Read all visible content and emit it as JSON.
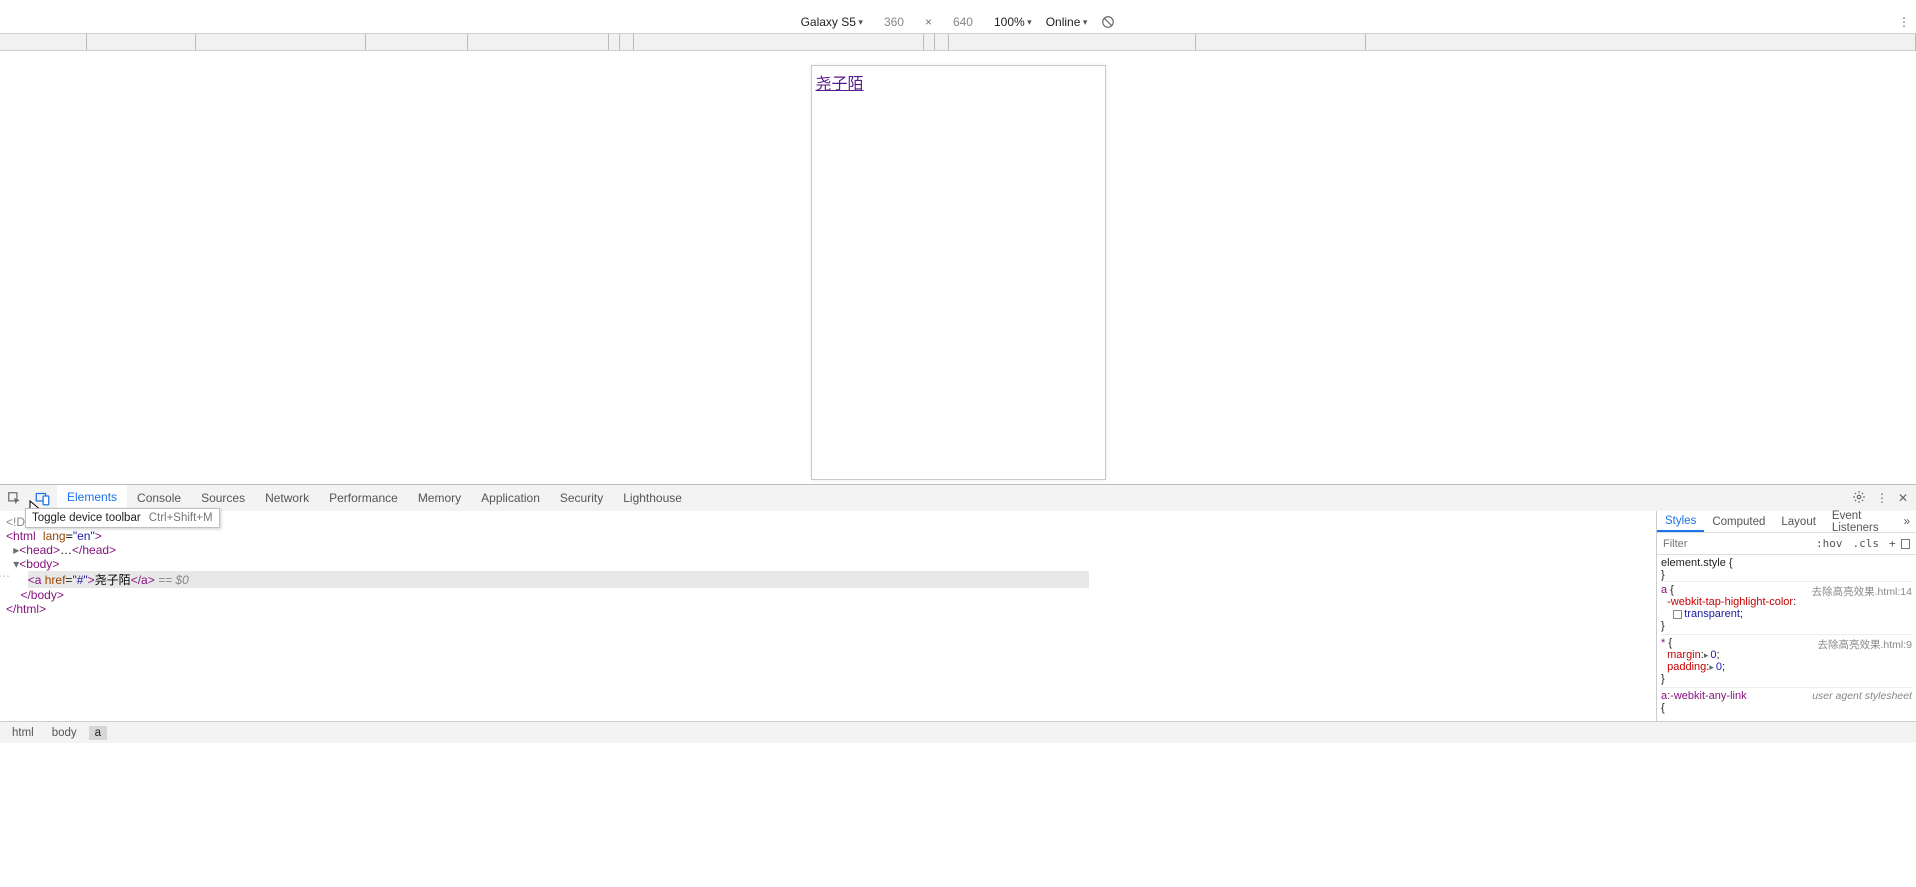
{
  "device_toolbar": {
    "device": "Galaxy S5",
    "width": "360",
    "height": "640",
    "separator": "×",
    "zoom": "100%",
    "throttle": "Online"
  },
  "page": {
    "link_text": "尧子陌"
  },
  "tooltip": {
    "label": "Toggle device toolbar",
    "shortcut": "Ctrl+Shift+M"
  },
  "devtools": {
    "tabs": [
      "Elements",
      "Console",
      "Sources",
      "Network",
      "Performance",
      "Memory",
      "Application",
      "Security",
      "Lighthouse"
    ],
    "active_tab": "Elements"
  },
  "dom": {
    "doctype": "<!DOCTYPE html>",
    "html_open_tag": "html",
    "html_attr1_name": "lang",
    "html_attr1_val": "en",
    "head_open": "head",
    "head_ellipsis": "…",
    "body_open": "body",
    "a_tag": "a",
    "a_attr_name": "href",
    "a_attr_val": "#",
    "a_text": "尧子陌",
    "eqvar": " == $0"
  },
  "styles_panel": {
    "tabs": [
      "Styles",
      "Computed",
      "Layout",
      "Event Listeners"
    ],
    "active_tab": "Styles",
    "filter_placeholder": "Filter",
    "hov": ":hov",
    "cls": ".cls",
    "element_style": "element.style",
    "origin1": "去除高亮效果.html:14",
    "origin2": "去除高亮效果.html:9",
    "rule_a_sel": "a",
    "rule_a_prop": "-webkit-tap-highlight-color",
    "rule_a_val": "transparent",
    "rule_star_sel": "*",
    "rule_star_p1": "margin",
    "rule_star_v1": "0",
    "rule_star_p2": "padding",
    "rule_star_v2": "0",
    "rule_ua_sel": "a:-webkit-any-link",
    "ua_label": "user agent stylesheet"
  },
  "crumbs": [
    "html",
    "body",
    "a"
  ]
}
